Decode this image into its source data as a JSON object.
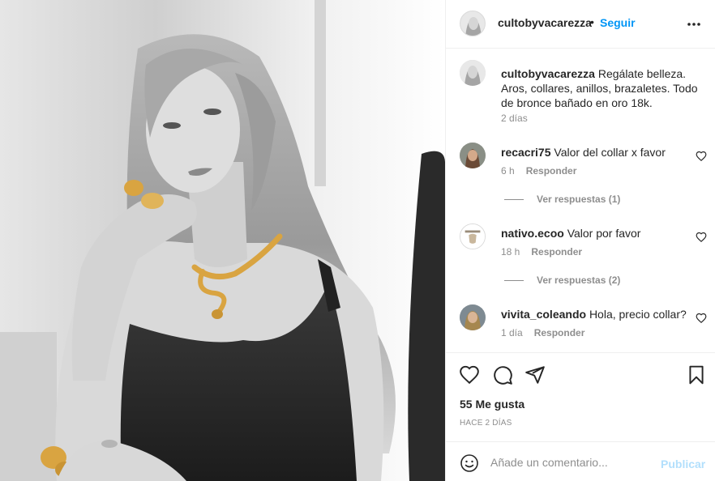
{
  "post": {
    "image_alt": "Mujer con collar de serpiente dorado y anillos dorados, foto en blanco y negro",
    "header": {
      "username": "cultobyvacarezza",
      "separator": "•",
      "follow_label": "Seguir",
      "more_icon": "more-horizontal-icon"
    },
    "caption": {
      "username": "cultobyvacarezza",
      "text": "Regálate belleza. Aros, collares, anillos, brazaletes. Todo de bronce bañado en oro 18k.",
      "time": "2 días"
    },
    "comments": [
      {
        "username": "recacri75",
        "text": "Valor del collar x favor",
        "time": "6 h",
        "reply_label": "Responder",
        "view_replies": "Ver respuestas (1)"
      },
      {
        "username": "nativo.ecoo",
        "text": "Valor por favor",
        "time": "18 h",
        "reply_label": "Responder",
        "view_replies": "Ver respuestas (2)"
      },
      {
        "username": "vivita_coleando",
        "text": "Hola, precio collar?",
        "time": "1 día",
        "reply_label": "Responder"
      }
    ],
    "actions": {
      "like_icon": "heart-icon",
      "comment_icon": "comment-icon",
      "share_icon": "paper-plane-icon",
      "save_icon": "bookmark-icon"
    },
    "likes": "55 Me gusta",
    "posted_ago": "HACE 2 DÍAS",
    "add_comment": {
      "placeholder": "Añade un comentario...",
      "publish_label": "Publicar",
      "emoji_icon": "smiley-icon"
    }
  },
  "colors": {
    "link_blue": "#0095f6",
    "publish_disabled": "#b2dffc",
    "secondary_text": "#8e8e8e",
    "gold": "#d9a441"
  }
}
